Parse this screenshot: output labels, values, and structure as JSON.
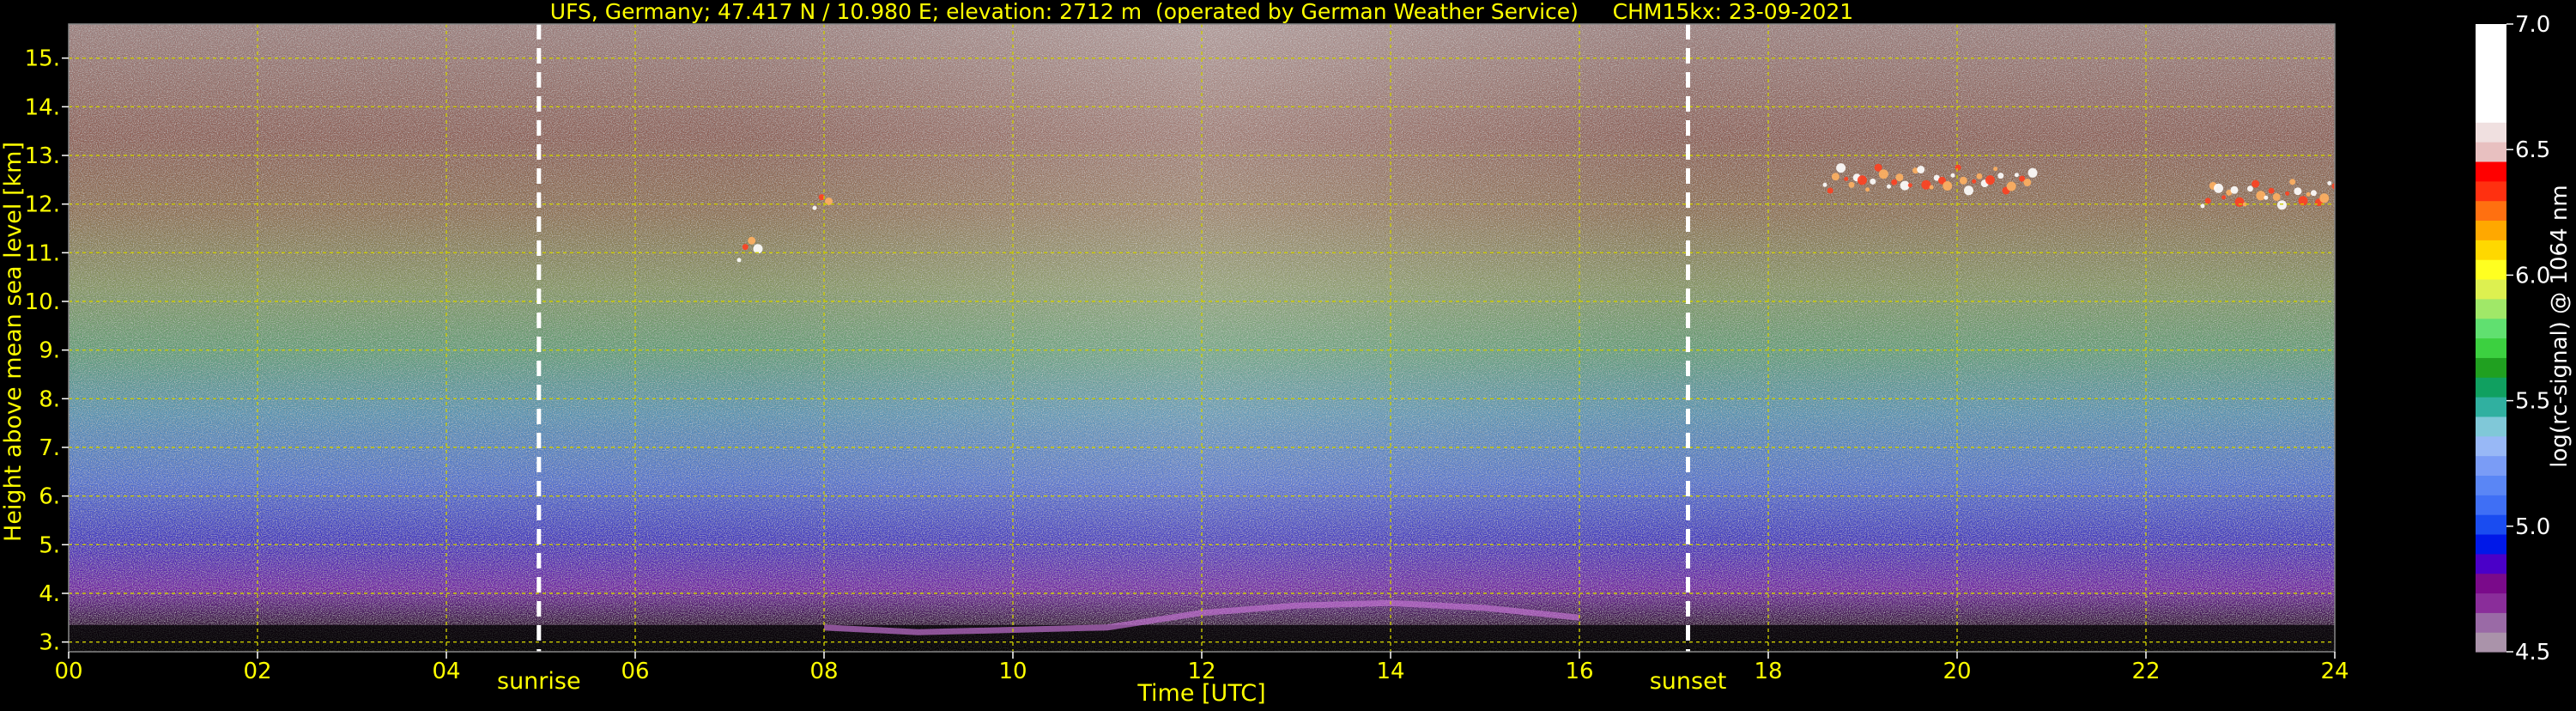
{
  "chart_data": {
    "type": "heatmap",
    "title": "UFS, Germany; 47.417 N / 10.980 E; elevation: 2712 m  (operated by German Weather Service)     CHM15kx: 23-09-2021",
    "xlabel": "Time [UTC]",
    "ylabel": "Height above mean sea level [km]",
    "xlim": [
      0,
      24
    ],
    "ylim": [
      2.8,
      15.7
    ],
    "x_ticks": [
      0,
      2,
      4,
      6,
      8,
      10,
      12,
      14,
      16,
      18,
      20,
      22,
      24
    ],
    "x_tick_labels": [
      "00",
      "02",
      "04",
      "06",
      "08",
      "10",
      "12",
      "14",
      "16",
      "18",
      "20",
      "22",
      "24"
    ],
    "y_ticks": [
      3,
      4,
      5,
      6,
      7,
      8,
      9,
      10,
      11,
      12,
      13,
      14,
      15
    ],
    "y_tick_labels": [
      "3.",
      "4.",
      "5.",
      "6.",
      "7.",
      "8.",
      "9.",
      "10.",
      "11.",
      "12.",
      "13.",
      "14.",
      "15."
    ],
    "grid": true,
    "annotations": [
      {
        "label": "sunrise",
        "x": 4.98
      },
      {
        "label": "sunset",
        "x": 17.15
      }
    ],
    "colorbar": {
      "label": "log(rc-signal) @ 1064 nm",
      "range": [
        4.5,
        7.0
      ],
      "tick_labels": [
        "4.5",
        "5.0",
        "5.5",
        "6.0",
        "6.5",
        "7.0"
      ],
      "tick_values": [
        4.5,
        5.0,
        5.5,
        6.0,
        6.5,
        7.0
      ]
    },
    "cloud_features": [
      {
        "x_start": 18.6,
        "x_end": 20.8,
        "height": 12.5
      },
      {
        "x_start": 22.6,
        "x_end": 24.0,
        "height": 12.2
      },
      {
        "x_start": 7.1,
        "x_end": 7.3,
        "height": 11.1
      },
      {
        "x_start": 7.9,
        "x_end": 8.05,
        "height": 12.05
      }
    ],
    "boundary_layer": [
      {
        "x": 8.0,
        "height": 3.3
      },
      {
        "x": 9.0,
        "height": 3.2
      },
      {
        "x": 10.0,
        "height": 3.25
      },
      {
        "x": 11.0,
        "height": 3.3
      },
      {
        "x": 12.0,
        "height": 3.6
      },
      {
        "x": 13.0,
        "height": 3.75
      },
      {
        "x": 14.0,
        "height": 3.8
      },
      {
        "x": 15.0,
        "height": 3.7
      },
      {
        "x": 16.0,
        "height": 3.5
      }
    ]
  },
  "colors": {
    "text": "#ffff00",
    "colorbar_text": "#ffffff",
    "grid": "#cccc00",
    "background": "#000000",
    "colormap": [
      "#aa93aa",
      "#9a6aa6",
      "#8a2d9a",
      "#7a0a8a",
      "#4a00c8",
      "#0018e8",
      "#1a4cf0",
      "#3f6ff5",
      "#5a86f5",
      "#7a9cf6",
      "#98b8f6",
      "#80c8d8",
      "#30b0a0",
      "#10a060",
      "#20a020",
      "#3cd040",
      "#60e070",
      "#a0e868",
      "#ddf050",
      "#ffff20",
      "#ffd800",
      "#ffa800",
      "#ff7010",
      "#ff3010",
      "#ff0000",
      "#e8c0c0",
      "#f0e0e0",
      "#ffffff",
      "#ffffff",
      "#ffffff",
      "#ffffff",
      "#ffffff"
    ]
  }
}
